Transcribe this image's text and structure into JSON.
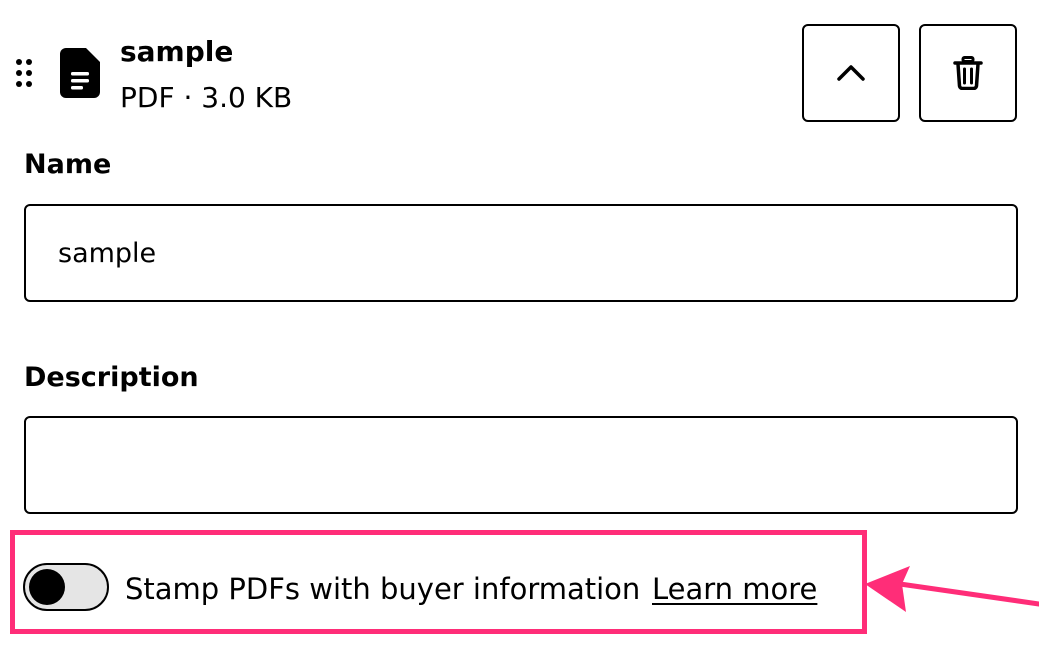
{
  "file": {
    "name": "sample",
    "meta": "PDF · 3.0 KB",
    "icon": "file-text-icon"
  },
  "actions": {
    "collapse_icon": "chevron-up-icon",
    "delete_icon": "trash-icon"
  },
  "form": {
    "name_label": "Name",
    "name_value": "sample",
    "description_label": "Description",
    "description_value": ""
  },
  "stamp": {
    "label": "Stamp PDFs with buyer information",
    "learn_more": "Learn more",
    "enabled": false
  },
  "colors": {
    "highlight": "#ff2d78",
    "toggle_track": "#e5e5e5",
    "border": "#000000"
  }
}
